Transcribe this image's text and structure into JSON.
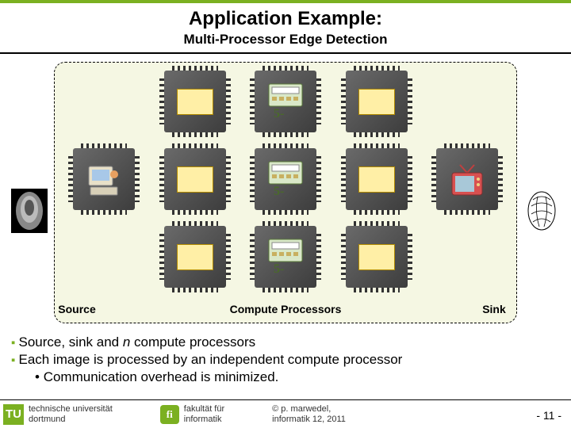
{
  "header": {
    "title": "Application Example:",
    "subtitle": "Multi-Processor Edge Detection"
  },
  "diagram": {
    "labels": {
      "source": "Source",
      "compute": "Compute Processors",
      "sink": "Sink"
    }
  },
  "bullets": {
    "b1_prefix": "Source,  sink and ",
    "b1_italic": "n",
    "b1_suffix": " compute processors",
    "b2": "Each image is processed by an independent compute processor",
    "b2sub": "Communication overhead is minimized."
  },
  "footer": {
    "tu_mark": "TU",
    "uni_line1": "technische universität",
    "uni_line2": "dortmund",
    "fi_mark": "fi",
    "fi_line1": "fakultät für",
    "fi_line2": "informatik",
    "copy_line1": "©  p. marwedel,",
    "copy_line2": "informatik 12,  2011",
    "page_prefix": "-  ",
    "page_num": "11",
    "page_suffix": " -"
  }
}
